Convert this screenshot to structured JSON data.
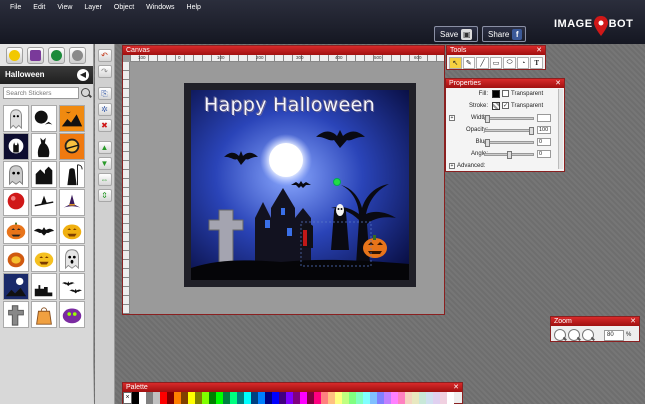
{
  "menu": [
    "File",
    "Edit",
    "View",
    "Layer",
    "Object",
    "Windows",
    "Help"
  ],
  "header": {
    "save_label": "Save",
    "share_label": "Share",
    "logo_left": "IMAGE",
    "logo_right": "BOT"
  },
  "sidebar": {
    "category": "Halloween",
    "search_placeholder": "Search Stickers",
    "tab_icons": [
      "smiley-icon",
      "star-icon",
      "cmd-icon",
      "gear-icon"
    ]
  },
  "canvas": {
    "title": "Canvas",
    "ruler_labels": [
      "100",
      "0",
      "100",
      "200",
      "300",
      "400",
      "500",
      "600"
    ],
    "scene_title": "Happy Halloween"
  },
  "tools": {
    "title": "Tools",
    "icons": [
      "select-arrow-icon",
      "pencil-icon",
      "line-icon",
      "rectangle-icon",
      "ellipse-icon",
      "shape-icon",
      "text-icon"
    ]
  },
  "properties": {
    "title": "Properties",
    "fill_label": "Fill:",
    "fill_option": "Transparent",
    "stroke_label": "Stroke:",
    "stroke_option": "Transparent",
    "width_label": "Width:",
    "opacity_label": "Opacity:",
    "opacity_value": "100",
    "blur_label": "Blur:",
    "blur_value": "0",
    "angle_label": "Angle:",
    "angle_value": "0",
    "advanced_label": "Advanced:"
  },
  "zoom": {
    "title": "Zoom",
    "value": "80",
    "unit": "%"
  },
  "palette": {
    "title": "Palette",
    "none_symbol": "×",
    "colors": [
      "#000000",
      "#ffffff",
      "#808080",
      "#c0c0c0",
      "#ff0000",
      "#800000",
      "#ff8000",
      "#804000",
      "#ffff00",
      "#808000",
      "#80ff00",
      "#008000",
      "#00ff00",
      "#008040",
      "#00ff80",
      "#008080",
      "#00ffff",
      "#004080",
      "#0080ff",
      "#000080",
      "#0000ff",
      "#400080",
      "#8000ff",
      "#800080",
      "#ff00ff",
      "#800040",
      "#ff0080",
      "#ff8080",
      "#ffc080",
      "#ffff80",
      "#c0ff80",
      "#80ff80",
      "#80ffc0",
      "#80ffff",
      "#80c0ff",
      "#8080ff",
      "#c080ff",
      "#ff80ff",
      "#ff80c0",
      "#f4d4c0",
      "#e8e8c0",
      "#c8e8d8",
      "#d0e0f0",
      "#e0d0f0",
      "#f0d0e0",
      "#ffffff"
    ]
  },
  "colors": {
    "panel_header": "#c01818",
    "topbar": "#1e2130"
  }
}
